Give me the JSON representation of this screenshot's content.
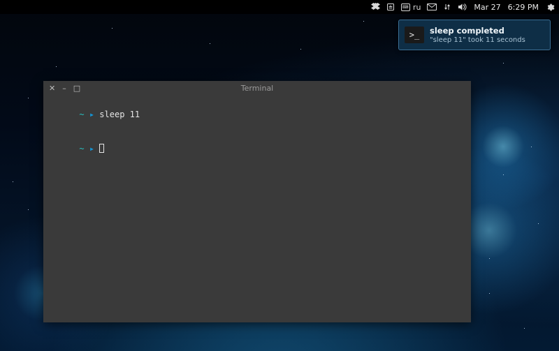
{
  "panel": {
    "keyboard_layout": "ru",
    "date": "Mar 27",
    "time": "6:29 PM"
  },
  "notification": {
    "title": "sleep completed",
    "body": "\"sleep 11\" took 11 seconds",
    "icon_glyph": ">_"
  },
  "terminal": {
    "title": "Terminal",
    "lines": [
      {
        "tilde": "~",
        "arrow": "▸",
        "cmd": "sleep 11"
      },
      {
        "tilde": "~",
        "arrow": "▸",
        "cmd": ""
      }
    ]
  }
}
